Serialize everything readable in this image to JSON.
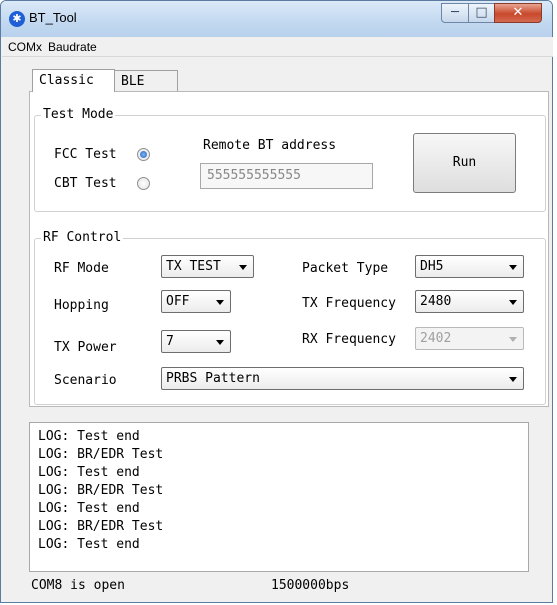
{
  "window": {
    "title": "BT_Tool",
    "app_icon": "bluetooth-icon"
  },
  "menu": {
    "items": [
      "COMx",
      "Baudrate"
    ]
  },
  "tabs": [
    {
      "label": "Classic",
      "active": true
    },
    {
      "label": "BLE",
      "active": false
    }
  ],
  "test_mode": {
    "group_label": "Test Mode",
    "fcc_label": "FCC Test",
    "cbt_label": "CBT Test",
    "fcc_selected": true,
    "remote_label": "Remote BT address",
    "remote_value": "555555555555",
    "run_label": "Run"
  },
  "rf_control": {
    "group_label": "RF Control",
    "rf_mode_label": "RF Mode",
    "rf_mode_value": "TX TEST",
    "hopping_label": "Hopping",
    "hopping_value": "OFF",
    "tx_power_label": "TX Power",
    "tx_power_value": "7",
    "scenario_label": "Scenario",
    "scenario_value": "PRBS Pattern",
    "packet_type_label": "Packet Type",
    "packet_type_value": "DH5",
    "tx_freq_label": "TX Frequency",
    "tx_freq_value": "2480",
    "rx_freq_label": "RX Frequency",
    "rx_freq_value": "2402"
  },
  "log": {
    "lines": [
      "LOG: Test end",
      "LOG: BR/EDR Test",
      "LOG: Test end",
      "LOG: BR/EDR Test",
      "LOG: Test end",
      "LOG: BR/EDR Test",
      "LOG: Test end"
    ]
  },
  "status": {
    "port": "COM8 is open",
    "baud": "1500000bps"
  },
  "colors": {
    "title_gradient": "#c2d8f0",
    "close_button": "#c9482c",
    "radio_checked": "#1e5fbf"
  }
}
